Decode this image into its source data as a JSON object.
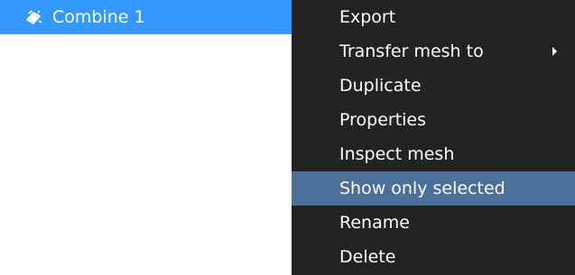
{
  "tree": {
    "selected_item": {
      "label": "Combine 1",
      "icon": "gear-object-icon"
    }
  },
  "context_menu": {
    "items": [
      {
        "label": "Export",
        "has_submenu": false,
        "highlighted": false
      },
      {
        "label": "Transfer mesh to",
        "has_submenu": true,
        "highlighted": false
      },
      {
        "label": "Duplicate",
        "has_submenu": false,
        "highlighted": false
      },
      {
        "label": "Properties",
        "has_submenu": false,
        "highlighted": false
      },
      {
        "label": "Inspect mesh",
        "has_submenu": false,
        "highlighted": false
      },
      {
        "label": "Show only selected",
        "has_submenu": false,
        "highlighted": true
      },
      {
        "label": "Rename",
        "has_submenu": false,
        "highlighted": false
      },
      {
        "label": "Delete",
        "has_submenu": false,
        "highlighted": false
      }
    ]
  },
  "colors": {
    "selection_blue": "#3399ff",
    "menu_background": "#222222",
    "menu_highlight": "#4a7099",
    "text": "#ffffff"
  }
}
